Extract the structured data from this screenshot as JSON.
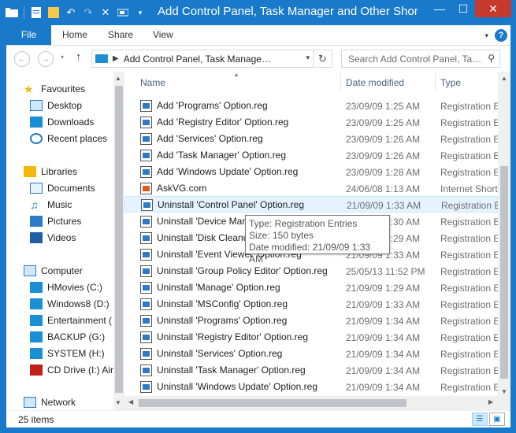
{
  "window": {
    "title": "Add Control Panel, Task Manager and Other Short…",
    "controls": {
      "minimize": "—",
      "maximize": "☐",
      "close": "✕"
    }
  },
  "ribbon": {
    "tabs": [
      "File",
      "Home",
      "Share",
      "View"
    ],
    "help": "?"
  },
  "nav": {
    "back": "←",
    "forward": "→",
    "up": "↑",
    "address_path": "Add Control Panel, Task Manage…",
    "search_placeholder": "Search Add Control Panel, Ta…"
  },
  "sidebar": {
    "items": [
      {
        "label": "Favourites",
        "icon": "star-icon"
      },
      {
        "label": "Desktop",
        "icon": "desktop-icon"
      },
      {
        "label": "Downloads",
        "icon": "downloads-icon"
      },
      {
        "label": "Recent places",
        "icon": "recent-places-icon"
      },
      {
        "label": "Libraries",
        "icon": "libraries-icon"
      },
      {
        "label": "Documents",
        "icon": "documents-icon"
      },
      {
        "label": "Music",
        "icon": "music-icon"
      },
      {
        "label": "Pictures",
        "icon": "pictures-icon"
      },
      {
        "label": "Videos",
        "icon": "videos-icon"
      },
      {
        "label": "Computer",
        "icon": "computer-icon"
      },
      {
        "label": "HMovies (C:)",
        "icon": "drive-icon"
      },
      {
        "label": "Windows8 (D:)",
        "icon": "windows-drive-icon"
      },
      {
        "label": "Entertainment (",
        "icon": "drive-icon"
      },
      {
        "label": "BACKUP (G:)",
        "icon": "drive-icon"
      },
      {
        "label": "SYSTEM (H:)",
        "icon": "drive-icon"
      },
      {
        "label": "CD Drive (I:) Air",
        "icon": "cd-drive-icon"
      },
      {
        "label": "Network",
        "icon": "network-icon"
      }
    ]
  },
  "columns": {
    "name": "Name",
    "date": "Date modified",
    "type": "Type"
  },
  "files": [
    {
      "name": "Add 'Programs' Option.reg",
      "date": "23/09/09 1:25 AM",
      "type": "Registration E"
    },
    {
      "name": "Add 'Registry Editor' Option.reg",
      "date": "23/09/09 1:25 AM",
      "type": "Registration E"
    },
    {
      "name": "Add 'Services' Option.reg",
      "date": "23/09/09 1:26 AM",
      "type": "Registration E"
    },
    {
      "name": "Add 'Task Manager' Option.reg",
      "date": "23/09/09 1:26 AM",
      "type": "Registration E"
    },
    {
      "name": "Add 'Windows Update' Option.reg",
      "date": "23/09/09 1:28 AM",
      "type": "Registration E"
    },
    {
      "name": "AskVG.com",
      "date": "24/06/08 1:13 AM",
      "type": "Internet Short"
    },
    {
      "name": "Uninstall 'Control Panel' Option.reg",
      "date": "21/09/09 1:33 AM",
      "type": "Registration E"
    },
    {
      "name": "Uninstall 'Device Manager' Option.reg",
      "date": "21/09/09 1:30 AM",
      "type": "Registration E"
    },
    {
      "name": "Uninstall 'Disk Cleanup' Option.reg",
      "date": "21/09/09 1:29 AM",
      "type": "Registration E"
    },
    {
      "name": "Uninstall 'Event Viewer' Option.reg",
      "date": "21/09/09 1:33 AM",
      "type": "Registration E"
    },
    {
      "name": "Uninstall 'Group Policy Editor' Option.reg",
      "date": "25/05/13 11:52 PM",
      "type": "Registration E"
    },
    {
      "name": "Uninstall 'Manage' Option.reg",
      "date": "21/09/09 1:29 AM",
      "type": "Registration E"
    },
    {
      "name": "Uninstall 'MSConfig' Option.reg",
      "date": "21/09/09 1:33 AM",
      "type": "Registration E"
    },
    {
      "name": "Uninstall 'Programs' Option.reg",
      "date": "21/09/09 1:34 AM",
      "type": "Registration E"
    },
    {
      "name": "Uninstall 'Registry Editor' Option.reg",
      "date": "21/09/09 1:34 AM",
      "type": "Registration E"
    },
    {
      "name": "Uninstall 'Services' Option.reg",
      "date": "21/09/09 1:34 AM",
      "type": "Registration E"
    },
    {
      "name": "Uninstall 'Task Manager' Option.reg",
      "date": "21/09/09 1:34 AM",
      "type": "Registration E"
    },
    {
      "name": "Uninstall 'Windows Update' Option.reg",
      "date": "21/09/09 1:34 AM",
      "type": "Registration E"
    }
  ],
  "tooltip": {
    "type_line": "Type: Registration Entries",
    "size_line": "Size: 150 bytes",
    "date_line": "Date modified: 21/09/09 1:33 AM"
  },
  "status": {
    "count": "25 items"
  },
  "colors": {
    "accent": "#1979ca",
    "close": "#c7392c",
    "selection": "#e5f3ff"
  }
}
